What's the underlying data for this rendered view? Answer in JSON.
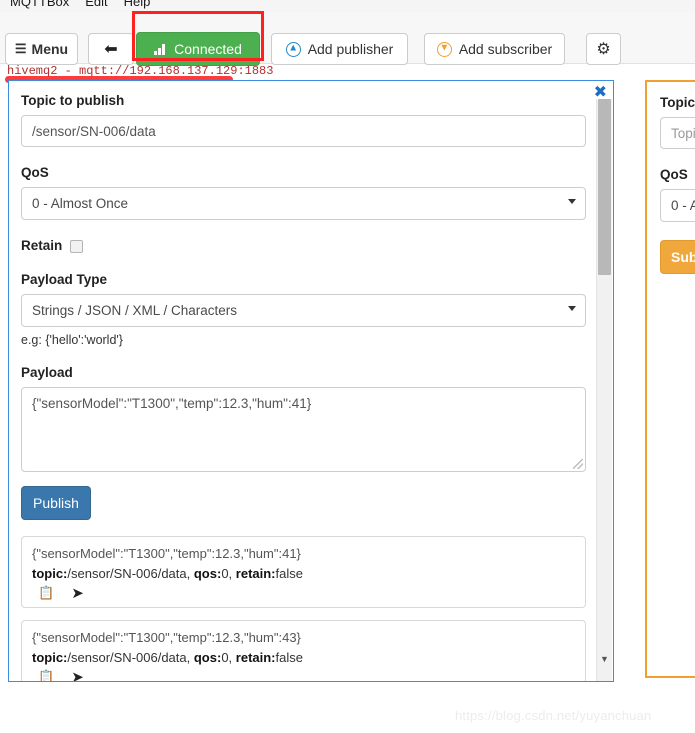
{
  "menubar": {
    "items": [
      "MQTTBox",
      "Edit",
      "Help"
    ]
  },
  "toolbar": {
    "menu_label": "Menu",
    "menu_icon": "hamburger-icon",
    "back_icon": "arrow-left-icon",
    "connected_label": "Connected",
    "connected_icon": "signal-bars-icon",
    "connected_color": "#4cb050",
    "add_publisher_label": "Add publisher",
    "add_publisher_icon": "circle-arrow-up-icon",
    "add_publisher_icon_color": "#2288cc",
    "add_subscriber_label": "Add subscriber",
    "add_subscriber_icon": "circle-arrow-down-icon",
    "add_subscriber_icon_color": "#f0a030",
    "settings_icon": "gear-icon"
  },
  "annotation": {
    "box_color": "#ff2020",
    "underline_color": "#ff3b3b"
  },
  "connection": {
    "label": "hivemq2 - mqtt://192.168.137.129:1883",
    "color": "#b03030"
  },
  "publisher": {
    "border_color": "#3c8dde",
    "close_icon": "close-icon",
    "topic_label": "Topic to publish",
    "topic_value": "/sensor/SN-006/data",
    "qos_label": "QoS",
    "qos_value": "0 - Almost Once",
    "retain_label": "Retain",
    "retain_checked": false,
    "payload_type_label": "Payload Type",
    "payload_type_value": "Strings / JSON / XML / Characters",
    "payload_hint": "e.g: {'hello':'world'}",
    "payload_label": "Payload",
    "payload_value": "{\"sensorModel\":\"T1300\",\"temp\":12.3,\"hum\":41}",
    "publish_label": "Publish",
    "publish_color": "#3a77ad",
    "messages": [
      {
        "payload": "{\"sensorModel\":\"T1300\",\"temp\":12.3,\"hum\":41}",
        "topic_key": "topic:",
        "topic_value": "/sensor/SN-006/data, ",
        "qos_key": "qos:",
        "qos_value": "0, ",
        "retain_key": "retain:",
        "retain_value": "false",
        "copy_icon": "copy-icon",
        "share_icon": "share-arrow-icon"
      },
      {
        "payload": "{\"sensorModel\":\"T1300\",\"temp\":12.3,\"hum\":43}",
        "topic_key": "topic:",
        "topic_value": "/sensor/SN-006/data, ",
        "qos_key": "qos:",
        "qos_value": "0, ",
        "retain_key": "retain:",
        "retain_value": "false",
        "copy_icon": "copy-icon",
        "share_icon": "share-arrow-icon"
      }
    ],
    "scroll_down_icon": "chevron-down-icon"
  },
  "subscriber": {
    "border_color": "#f0a030",
    "topic_label": "Topic",
    "topic_placeholder": "Topi",
    "qos_label": "QoS",
    "qos_value": "0 - A",
    "subscribe_label": "Subs",
    "subscribe_color": "#f0a83c"
  },
  "watermark": {
    "text": "https://blog.csdn.net/yuyanchuan"
  }
}
